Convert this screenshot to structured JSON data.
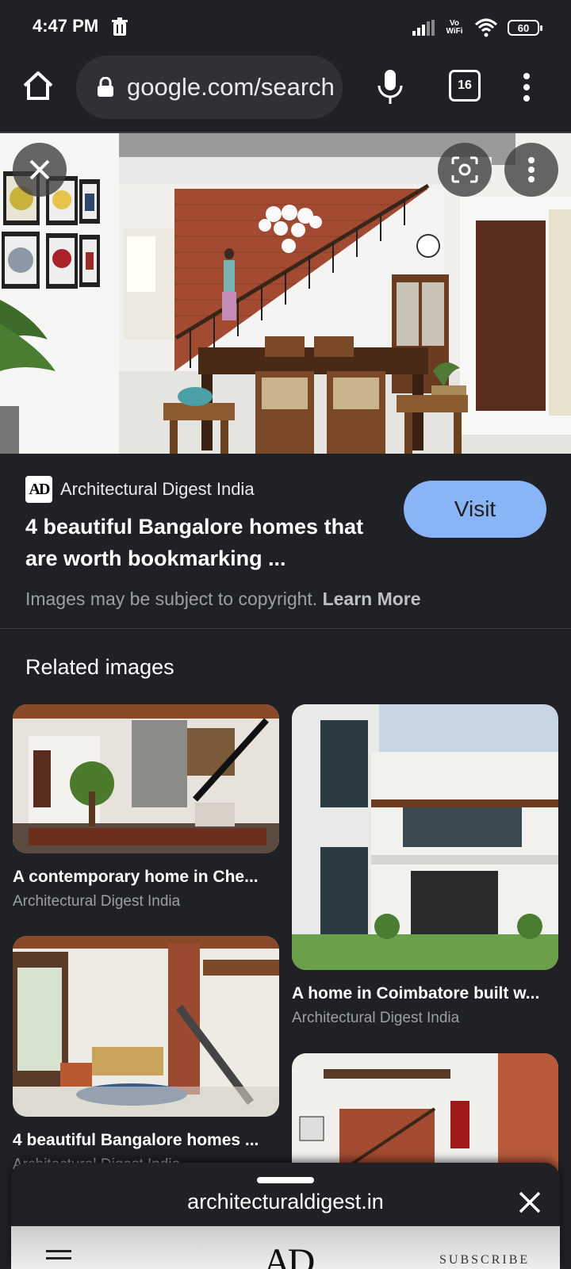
{
  "status_bar": {
    "time": "4:47 PM",
    "network_label": "Vo WiFi",
    "battery": "60"
  },
  "toolbar": {
    "url": "google.com/search",
    "tab_count": "16"
  },
  "result": {
    "source": "Architectural Digest India",
    "logo_text": "AD",
    "title": "4 beautiful Bangalore homes that are worth bookmarking ...",
    "visit_label": "Visit",
    "copyright_text": "Images may be subject to copyright.",
    "learn_more": "Learn More"
  },
  "related": {
    "heading": "Related images",
    "items": [
      {
        "title": "A contemporary home in Che...",
        "source": "Architectural Digest India"
      },
      {
        "title": "A home in Coimbatore built w...",
        "source": "Architectural Digest India"
      },
      {
        "title": "4 beautiful Bangalore homes ...",
        "source": "Architectural Digest India"
      },
      {
        "title": "",
        "source": ""
      }
    ]
  },
  "sheet": {
    "url": "architecturaldigest.in",
    "preview_logo": "AD",
    "preview_subscribe": "SUBSCRIBE"
  },
  "colors": {
    "background": "#202124",
    "visit_button": "#8ab4f8",
    "omnibox": "#303134"
  }
}
